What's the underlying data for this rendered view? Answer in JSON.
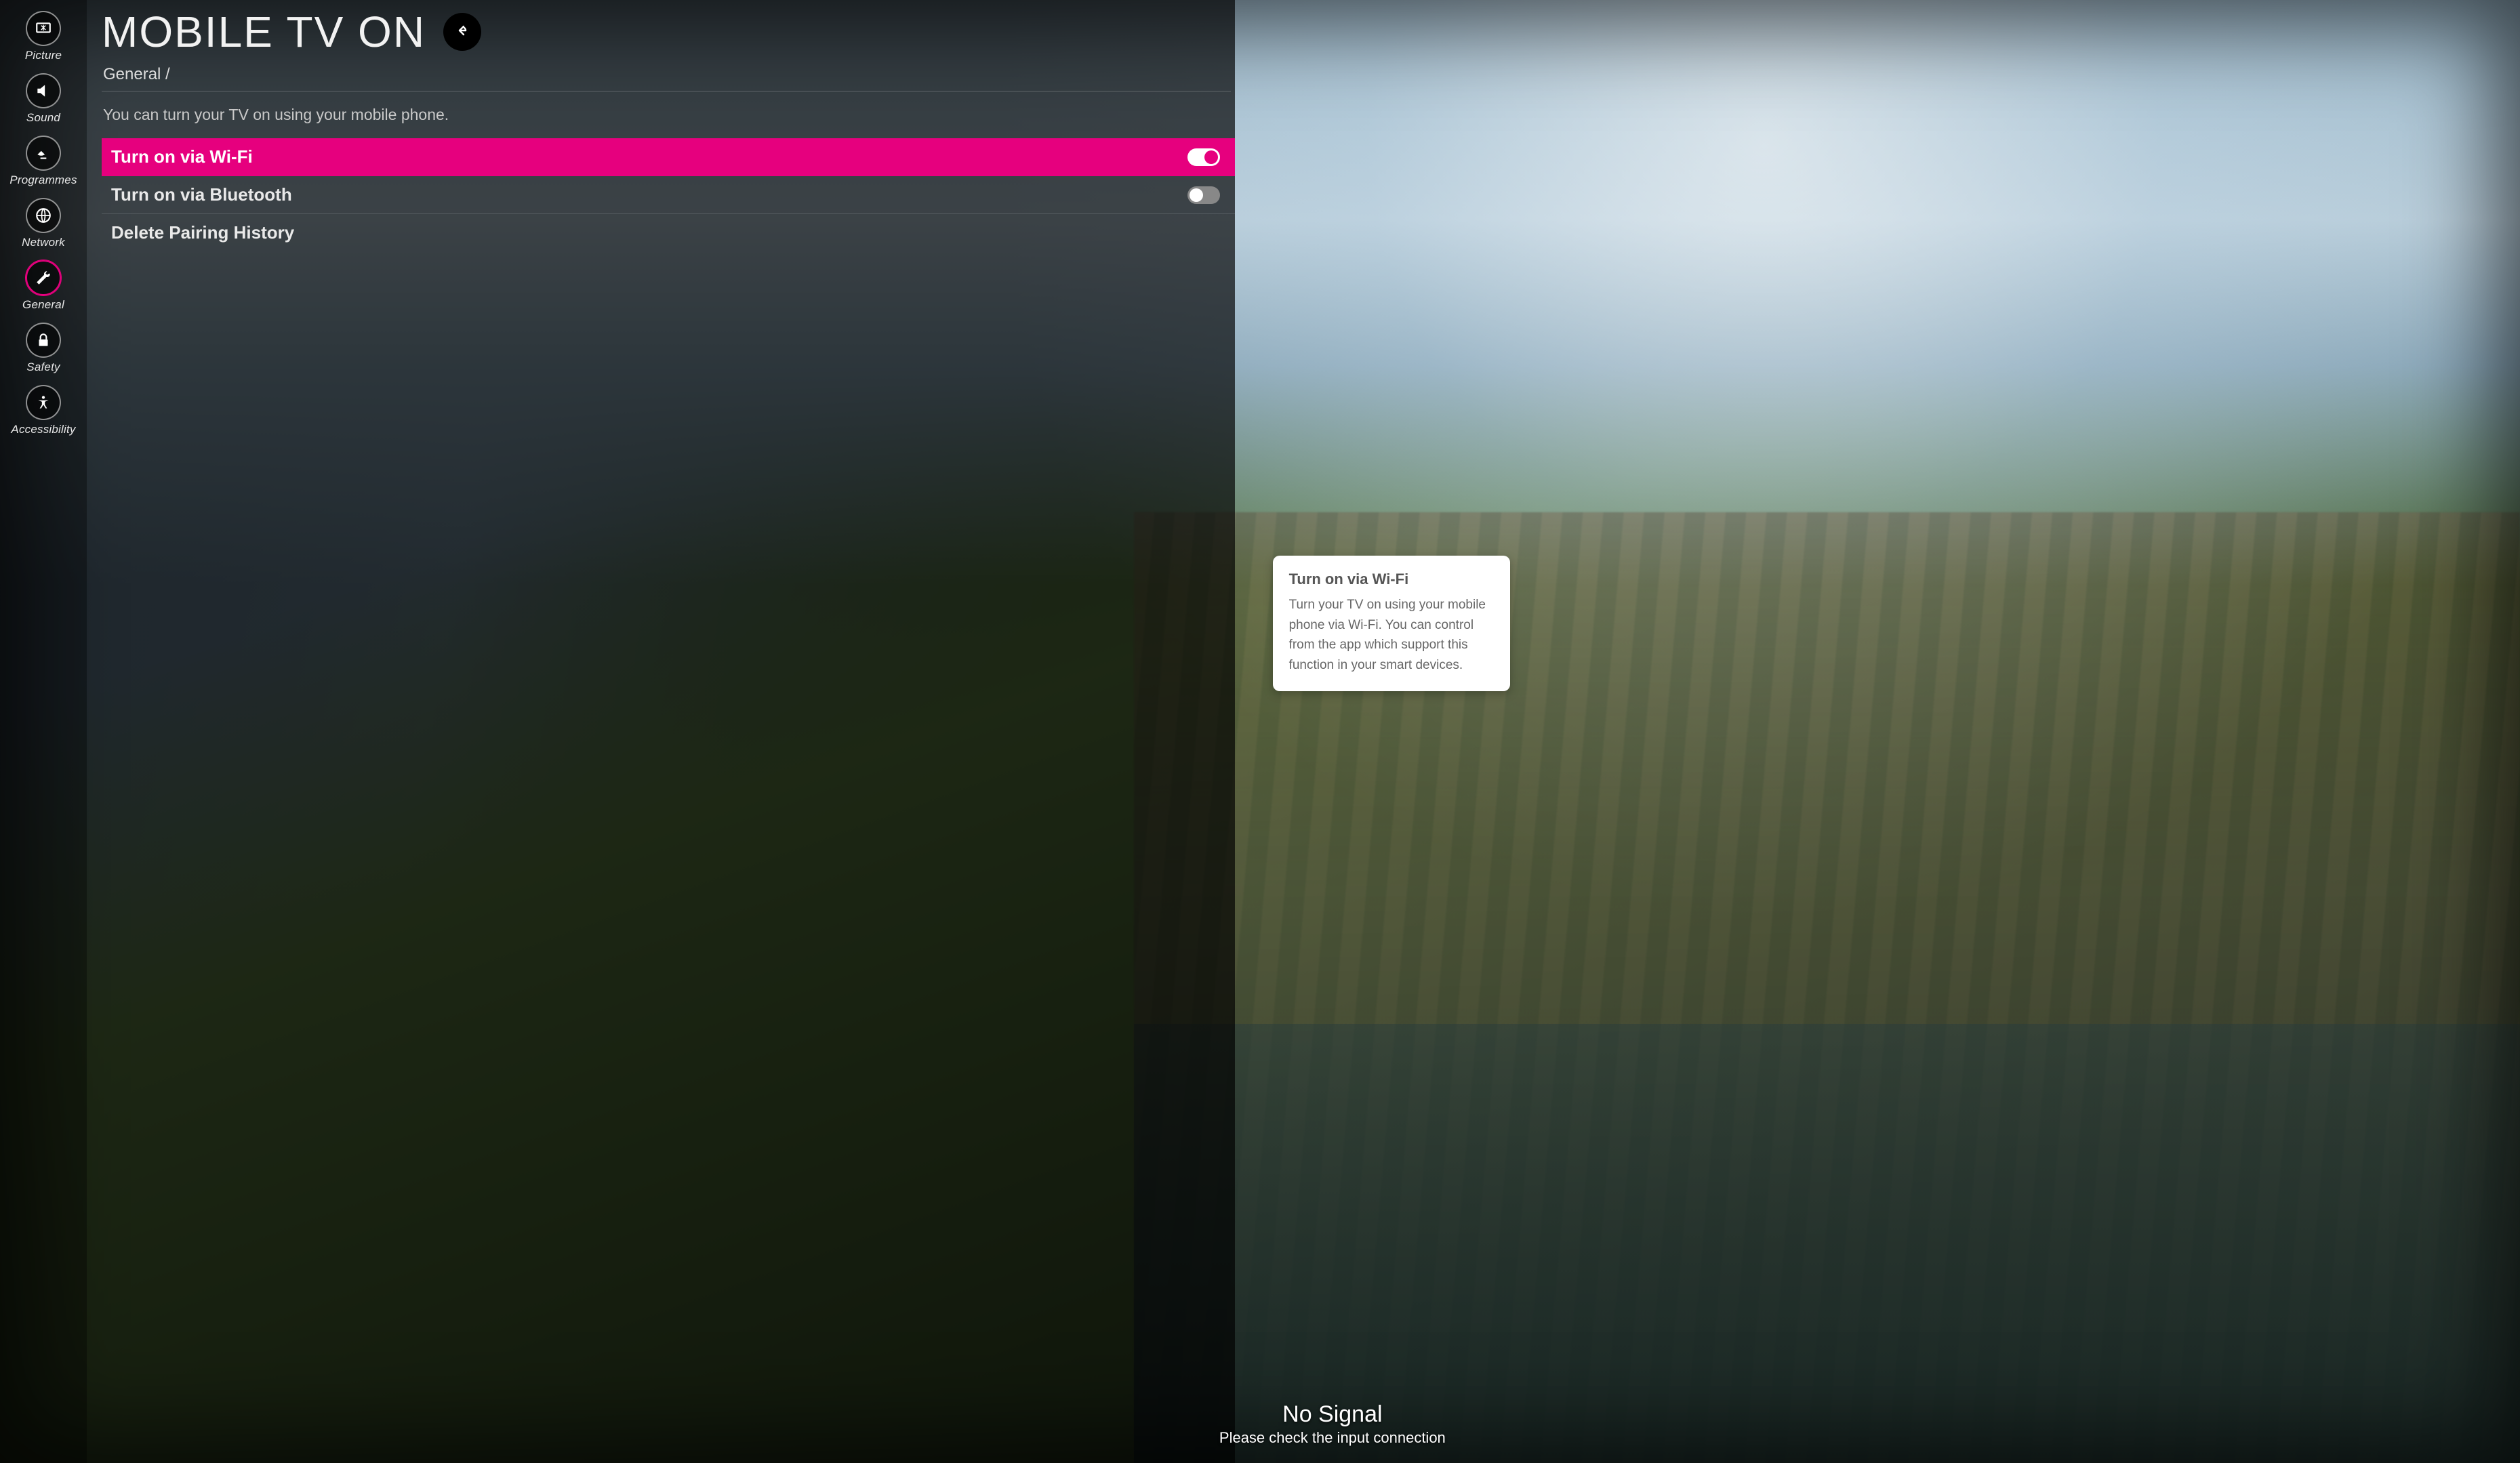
{
  "sidebar": {
    "items": [
      {
        "key": "picture",
        "label": "Picture",
        "active": false
      },
      {
        "key": "sound",
        "label": "Sound",
        "active": false
      },
      {
        "key": "programmes",
        "label": "Programmes",
        "active": false
      },
      {
        "key": "network",
        "label": "Network",
        "active": false
      },
      {
        "key": "general",
        "label": "General",
        "active": true
      },
      {
        "key": "safety",
        "label": "Safety",
        "active": false
      },
      {
        "key": "accessibility",
        "label": "Accessibility",
        "active": false
      }
    ]
  },
  "page": {
    "title": "MOBILE TV ON",
    "breadcrumb": "General /",
    "description": "You can turn your TV on using your mobile phone."
  },
  "options": [
    {
      "key": "wifi",
      "label": "Turn on via Wi-Fi",
      "toggle": "on",
      "highlighted": true
    },
    {
      "key": "bt",
      "label": "Turn on via Bluetooth",
      "toggle": "off",
      "highlighted": false
    },
    {
      "key": "delpair",
      "label": "Delete Pairing History",
      "toggle": null,
      "highlighted": false
    }
  ],
  "help": {
    "title": "Turn on via Wi-Fi",
    "body": "Turn your TV on using your mobile phone via Wi-Fi. You can control from the app which support this function in your smart devices."
  },
  "overlay": {
    "no_signal_title": "No Signal",
    "no_signal_sub": "Please check the input connection"
  },
  "colors": {
    "accent": "#e6007e"
  }
}
